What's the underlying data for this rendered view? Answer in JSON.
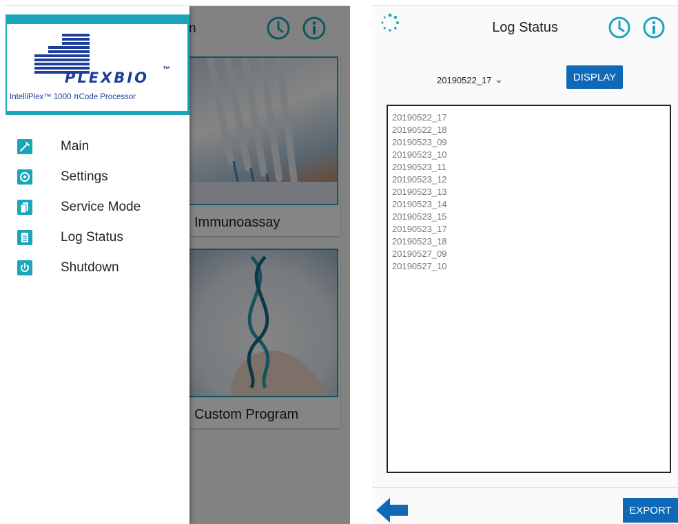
{
  "left": {
    "background": {
      "header_title_fragment": "n",
      "cards": [
        {
          "label": "Immunoassay"
        },
        {
          "label": "Custom Program"
        }
      ]
    },
    "drawer": {
      "logo": {
        "brand": "PLEXBIO",
        "tm": "™",
        "subtitle": "IntelliPlex™ 1000 πCode Processor"
      },
      "menu": [
        {
          "label": "Main",
          "icon": "pipette-icon"
        },
        {
          "label": "Settings",
          "icon": "settings-icon"
        },
        {
          "label": "Service Mode",
          "icon": "service-mode-icon"
        },
        {
          "label": "Log Status",
          "icon": "log-document-icon"
        },
        {
          "label": "Shutdown",
          "icon": "power-icon"
        }
      ]
    }
  },
  "right": {
    "title": "Log Status",
    "selected_log": "20190522_17",
    "display_label": "DISPLAY",
    "export_label": "EXPORT",
    "log_entries": [
      "20190522_17",
      "20190522_18",
      "20190523_09",
      "20190523_10",
      "20190523_11",
      "20190523_12",
      "20190523_13",
      "20190523_14",
      "20190523_15",
      "20190523_17",
      "20190523_18",
      "20190527_09",
      "20190527_10"
    ]
  },
  "colors": {
    "accent_teal": "#1aa5b8",
    "button_blue": "#1069b7",
    "logo_blue": "#1d3d9a"
  }
}
